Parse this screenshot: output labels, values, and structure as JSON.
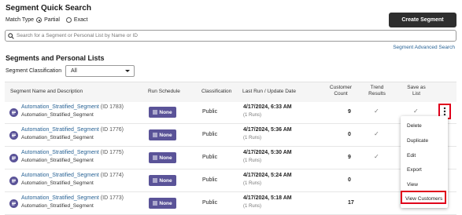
{
  "quick_search": {
    "title": "Segment Quick Search",
    "match_type_label": "Match Type",
    "options": [
      "Partial",
      "Exact"
    ],
    "selected": "Partial",
    "create_button": "Create Segment",
    "search_placeholder": "Search for a Segment or Personal List by Name or ID",
    "advanced_link": "Segment Advanced Search"
  },
  "list_section": {
    "title": "Segments and Personal Lists",
    "classification_label": "Segment Classification",
    "classification_value": "All"
  },
  "table": {
    "headers": {
      "name": "Segment Name and Description",
      "run_schedule": "Run Schedule",
      "classification": "Classification",
      "last_run": "Last Run / Update Date",
      "customer_count_1": "Customer",
      "customer_count_2": "Count",
      "trend_1": "Trend",
      "trend_2": "Results",
      "save_1": "Save as",
      "save_2": "List"
    },
    "rows": [
      {
        "name": "Automation_Stratified_Segment",
        "id": "(ID 1783)",
        "desc": "Automation_Stratified_Segment",
        "schedule": "None",
        "classification": "Public",
        "date": "4/17/2024, 6:33 AM",
        "runs": "(1 Runs)",
        "count": "9",
        "trend": true,
        "save": true
      },
      {
        "name": "Automation_Stratified_Segment",
        "id": "(ID 1776)",
        "desc": "Automation_Stratified_Segment",
        "schedule": "None",
        "classification": "Public",
        "date": "4/17/2024, 5:36 AM",
        "runs": "(1 Runs)",
        "count": "0",
        "trend": true,
        "save": false
      },
      {
        "name": "Automation_Stratified_Segment",
        "id": "(ID 1775)",
        "desc": "Automation_Stratified_Segment",
        "schedule": "None",
        "classification": "Public",
        "date": "4/17/2024, 5:30 AM",
        "runs": "(1 Runs)",
        "count": "9",
        "trend": true,
        "save": false
      },
      {
        "name": "Automation_Stratified_Segment",
        "id": "(ID 1774)",
        "desc": "Automation_Stratified_Segment",
        "schedule": "None",
        "classification": "Public",
        "date": "4/17/2024, 5:24 AM",
        "runs": "(1 Runs)",
        "count": "0",
        "trend": false,
        "save": false
      },
      {
        "name": "Automation_Stratified_Segment",
        "id": "(ID 1773)",
        "desc": "Automation_Stratified_Segment",
        "schedule": "None",
        "classification": "Public",
        "date": "4/17/2024, 5:18 AM",
        "runs": "(1 Runs)",
        "count": "17",
        "trend": false,
        "save": false
      }
    ]
  },
  "context_menu": {
    "items": [
      "Delete",
      "Duplicate",
      "Edit",
      "Export",
      "View",
      "View Customers"
    ]
  },
  "colors": {
    "accent": "#5a5398",
    "link": "#2a6496",
    "highlight": "#e0001b",
    "primary_button": "#2e2e2e"
  }
}
